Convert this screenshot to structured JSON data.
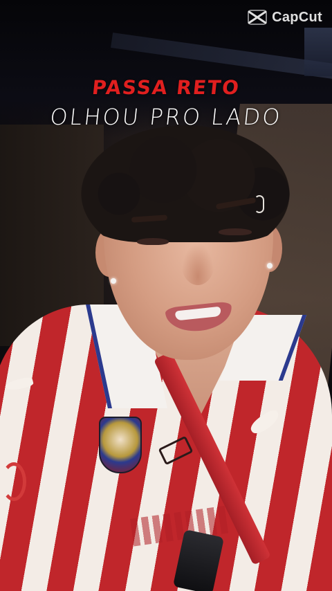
{
  "watermark": {
    "text": "CapCut",
    "icon": "capcut-logo-icon"
  },
  "caption": {
    "line1": "PASSA RETO",
    "line2": "OLHOU PRO LADO",
    "line1_color": "#e01f1f",
    "line2_color": "#ffffff"
  }
}
